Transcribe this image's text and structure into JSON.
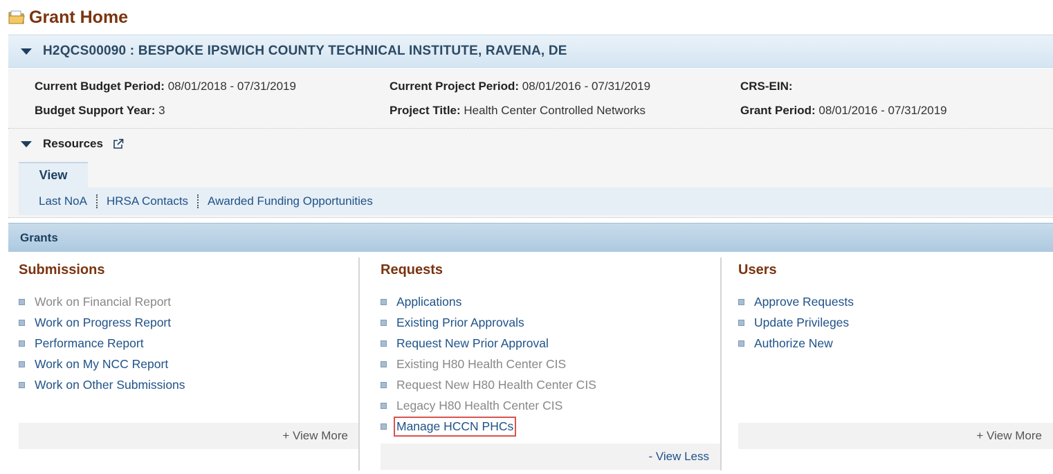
{
  "page": {
    "title": "Grant Home"
  },
  "grant": {
    "header": "H2QCS00090 : BESPOKE IPSWICH COUNTY TECHNICAL INSTITUTE, RAVENA, DE",
    "current_budget_period": {
      "label": "Current Budget Period:",
      "value": "08/01/2018 - 07/31/2019"
    },
    "budget_support_year": {
      "label": "Budget Support Year:",
      "value": "3"
    },
    "current_project_period": {
      "label": "Current Project Period:",
      "value": "08/01/2016 - 07/31/2019"
    },
    "project_title": {
      "label": "Project Title:",
      "value": "Health Center Controlled Networks"
    },
    "crs_ein": {
      "label": "CRS-EIN:",
      "value": ""
    },
    "grant_period": {
      "label": "Grant Period:",
      "value": "08/01/2016 - 07/31/2019"
    }
  },
  "resources": {
    "label": "Resources",
    "tab": "View",
    "links": [
      "Last NoA",
      "HRSA Contacts",
      "Awarded Funding Opportunities"
    ]
  },
  "grants": {
    "label": "Grants",
    "submissions": {
      "title": "Submissions",
      "items": [
        {
          "label": "Work on Financial Report",
          "enabled": false
        },
        {
          "label": "Work on Progress Report",
          "enabled": true
        },
        {
          "label": "Performance Report",
          "enabled": true
        },
        {
          "label": "Work on My NCC Report",
          "enabled": true
        },
        {
          "label": "Work on Other Submissions",
          "enabled": true
        }
      ],
      "footer": "+ View More"
    },
    "requests": {
      "title": "Requests",
      "items": [
        {
          "label": "Applications",
          "enabled": true
        },
        {
          "label": "Existing Prior Approvals",
          "enabled": true
        },
        {
          "label": "Request New Prior Approval",
          "enabled": true
        },
        {
          "label": "Existing H80 Health Center CIS",
          "enabled": false
        },
        {
          "label": "Request New H80 Health Center CIS",
          "enabled": false
        },
        {
          "label": "Legacy H80 Health Center CIS",
          "enabled": false
        },
        {
          "label": "Manage HCCN PHCs",
          "enabled": true,
          "highlighted": true
        }
      ],
      "footer": "- View Less"
    },
    "users": {
      "title": "Users",
      "items": [
        {
          "label": "Approve Requests",
          "enabled": true
        },
        {
          "label": "Update Privileges",
          "enabled": true
        },
        {
          "label": "Authorize New",
          "enabled": true
        }
      ],
      "footer": "+ View More"
    }
  },
  "colors": {
    "title_brown": "#7a3410",
    "link_blue": "#1f5288",
    "highlight_red": "#d9534f"
  }
}
